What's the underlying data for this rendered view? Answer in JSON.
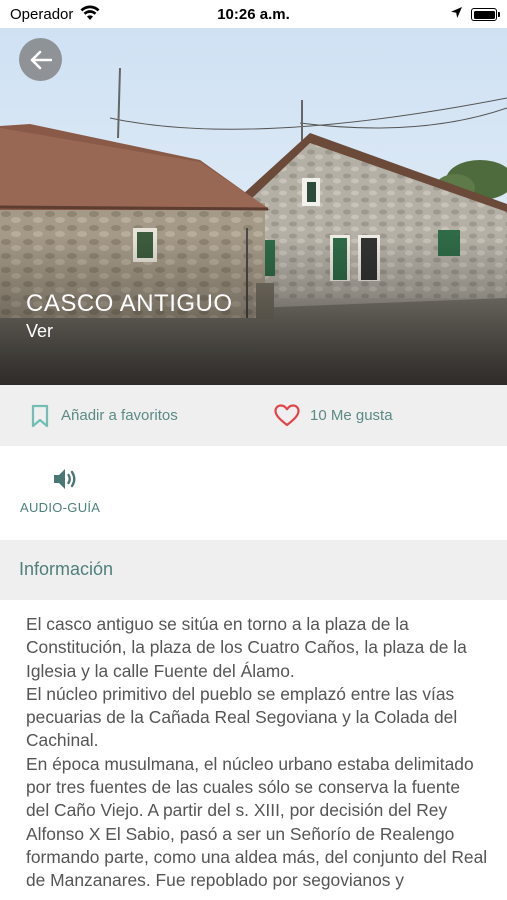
{
  "status_bar": {
    "carrier": "Operador",
    "time": "10:26 a.m."
  },
  "hero": {
    "title": "CASCO ANTIGUO",
    "subtitle": "Ver"
  },
  "actions": {
    "favorite_label": "Añadir a favoritos",
    "like_label": "10 Me gusta"
  },
  "audio": {
    "label": "AUDIO-GUÍA"
  },
  "info": {
    "header": "Información",
    "body": "El casco antiguo se sitúa en torno a la plaza de la Constitución, la plaza de los Cuatro Caños, la plaza de la Iglesia y la calle Fuente del Álamo.\nEl núcleo primitivo del pueblo se emplazó entre las vías pecuarias de la Cañada Real Segoviana y la Colada del Cachinal.\nEn época musulmana, el núcleo urbano estaba delimitado por tres fuentes de las cuales sólo se conserva la fuente del Caño Viejo. A partir del s. XIII, por decisión del Rey Alfonso X El Sabio, pasó a ser un Señorío de Realengo formando parte, como una aldea más, del conjunto del Real de Manzanares. Fue repoblado por segovianos y"
  },
  "colors": {
    "accent": "#5b8a86",
    "heart": "#e0454a",
    "section_bg": "#efefef",
    "body_text": "#555555"
  },
  "icons": {
    "back": "arrow-left-icon",
    "favorite": "bookmark-icon",
    "like": "heart-icon",
    "audio": "speaker-icon"
  }
}
